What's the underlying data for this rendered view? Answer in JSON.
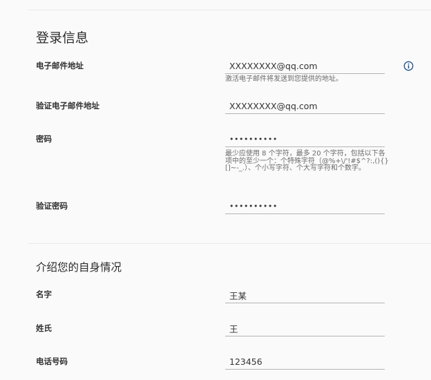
{
  "login_section": {
    "title": "登录信息",
    "email": {
      "label": "电子邮件地址",
      "value": "XXXXXXXX@qq.com",
      "help": "激活电子邮件将发送到您提供的地址。",
      "info_icon": "info-circle-icon"
    },
    "confirm_email": {
      "label": "验证电子邮件地址",
      "value": "XXXXXXXX@qq.com"
    },
    "password": {
      "label": "密码",
      "value": "••••••••••",
      "help": "最少应使用 8 个字符，最多 20 个字符，包括以下各项中的至少一个：个特殊字符（@%+\\/'!#$^?:,(){}[]~-_.）、个小写字符、个大写字符和个数字。"
    },
    "confirm_password": {
      "label": "验证密码",
      "value": "••••••••••"
    }
  },
  "about_section": {
    "title": "介绍您的自身情况",
    "first_name": {
      "label": "名字",
      "value": "王某"
    },
    "last_name": {
      "label": "姓氏",
      "value": "王"
    },
    "phone": {
      "label": "电话号码",
      "value": "123456"
    }
  },
  "colors": {
    "background": "#fafafa",
    "info_icon": "#1b4f8c",
    "field_underline": "#b3b3b3"
  }
}
